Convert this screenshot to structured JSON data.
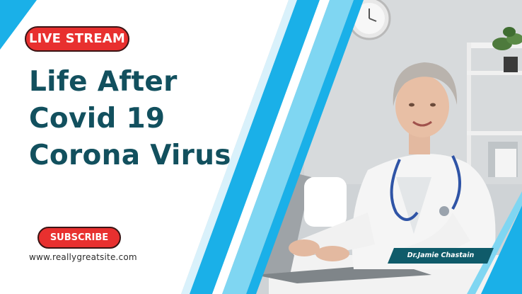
{
  "badge": {
    "label": "LIVE STREAM"
  },
  "headline": {
    "line1": "Life After",
    "line2": "Covid 19",
    "line3": "Corona Virus"
  },
  "subscribe": {
    "label": "SUBSCRIBE"
  },
  "website": {
    "url": "www.reallygreatsite.com"
  },
  "doctor": {
    "name": "Dr.Jamie Chastain"
  },
  "colors": {
    "accent_red": "#e8302f",
    "headline_teal": "#12505e",
    "stripe_cyan": "#1ab0e8",
    "stripe_light": "#7fd6f2",
    "name_tag": "#0f5b6a"
  },
  "icons": {
    "photo": "doctor-at-laptop-photo",
    "wall_clock": "wall-clock-icon",
    "plant": "potted-plant-icon"
  }
}
